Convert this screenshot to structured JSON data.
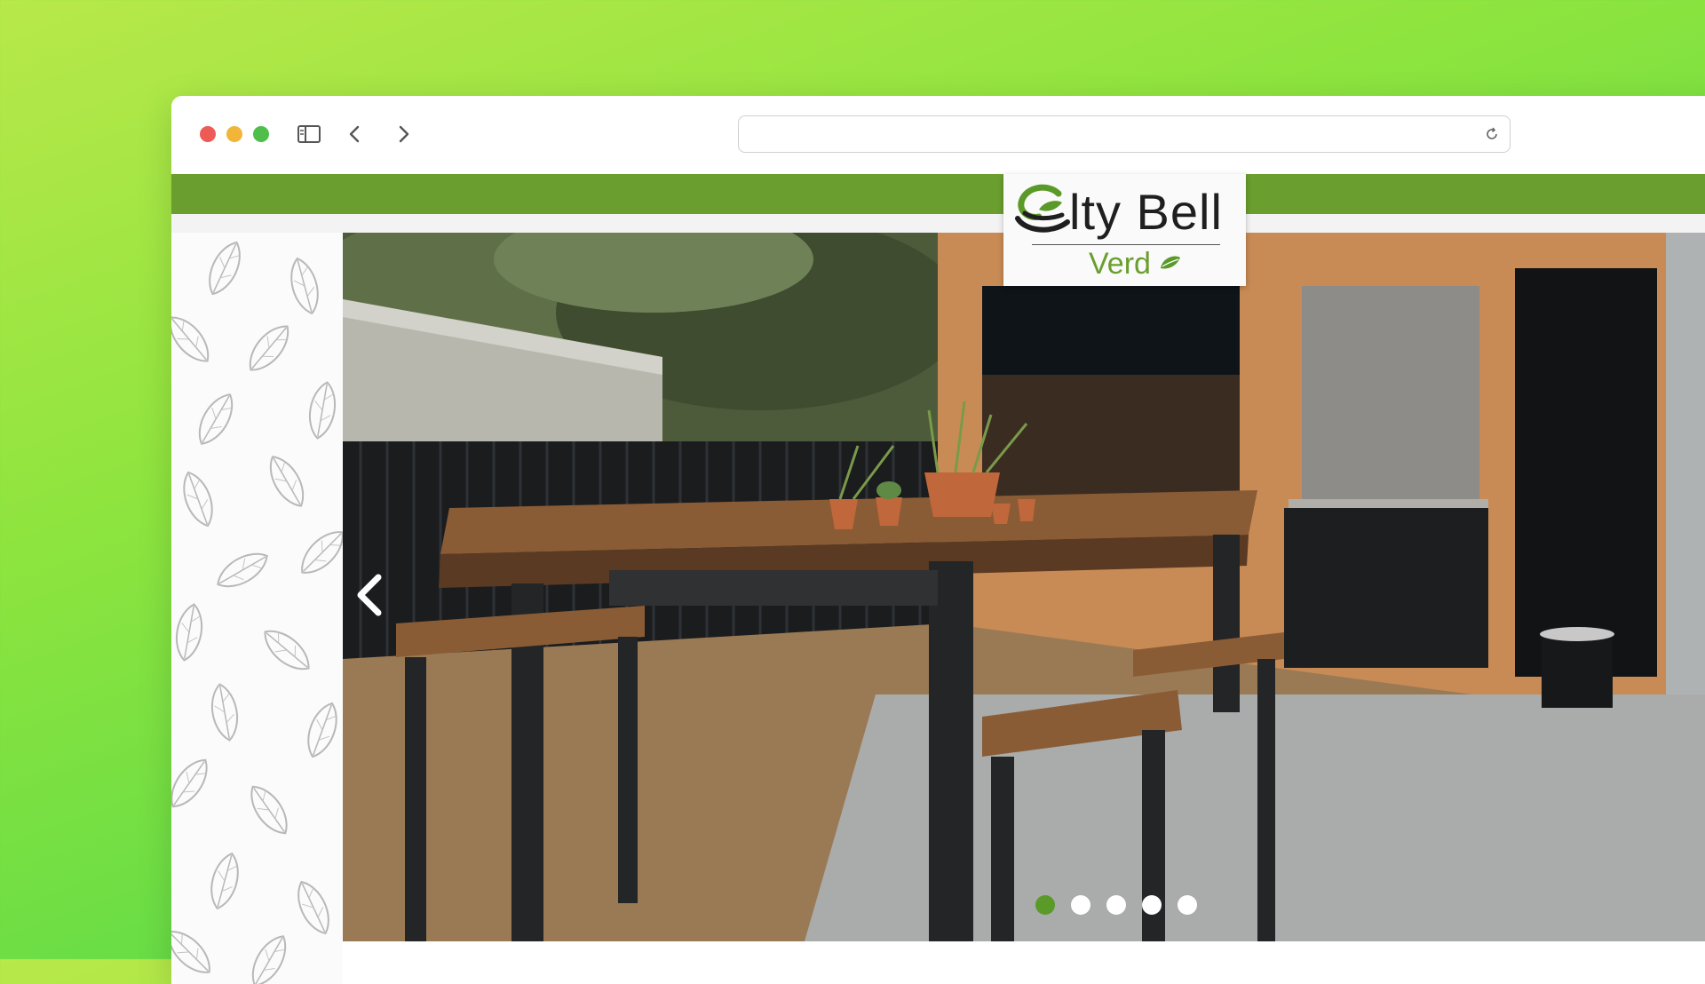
{
  "browser": {
    "url": "",
    "icons": {
      "sidebar": "sidebar-toggle-icon",
      "back": "chevron-left-icon",
      "forward": "chevron-right-icon",
      "reload": "reload-icon"
    }
  },
  "site": {
    "logo": {
      "title": "lty Bell",
      "subtitle": "Verd",
      "mark": "cup-with-leaf-icon"
    },
    "colors": {
      "brand_green": "#6a9e2e",
      "active_dot": "#5a9a28"
    }
  },
  "slider": {
    "slide_count": 5,
    "active_index": 0,
    "image_description": "patio-table-with-cactus-pots"
  }
}
